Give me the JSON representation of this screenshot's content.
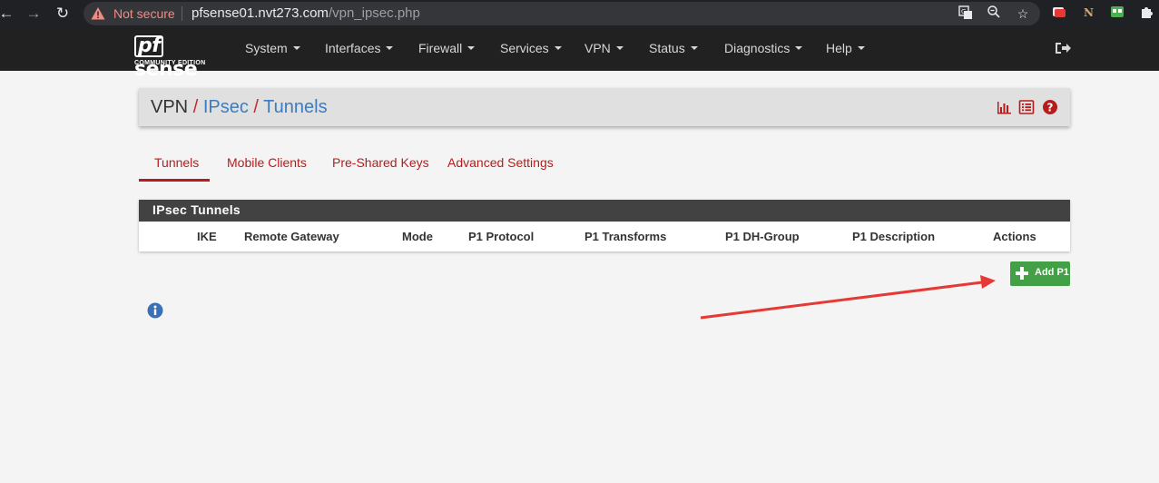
{
  "browser": {
    "security_label": "Not secure",
    "url_host": "pfsense01.nvt273.com",
    "url_path": "/vpn_ipsec.php",
    "back_icon": "arrow-left-icon",
    "forward_icon": "arrow-right-icon",
    "reload_icon": "reload-icon"
  },
  "navbar": {
    "logo_main": "sense",
    "logo_pf": "pf",
    "logo_sub": "COMMUNITY EDITION",
    "items": [
      {
        "label": "System"
      },
      {
        "label": "Interfaces"
      },
      {
        "label": "Firewall"
      },
      {
        "label": "Services"
      },
      {
        "label": "VPN"
      },
      {
        "label": "Status"
      },
      {
        "label": "Diagnostics"
      },
      {
        "label": "Help"
      }
    ]
  },
  "breadcrumb": {
    "part1": "VPN",
    "part2": "IPsec",
    "part3": "Tunnels",
    "separator": "/"
  },
  "tabs": [
    {
      "label": "Tunnels",
      "active": true
    },
    {
      "label": "Mobile Clients"
    },
    {
      "label": "Pre-Shared Keys"
    },
    {
      "label": "Advanced Settings"
    }
  ],
  "table": {
    "title": "IPsec Tunnels",
    "columns": [
      "IKE",
      "Remote Gateway",
      "Mode",
      "P1 Protocol",
      "P1 Transforms",
      "P1 DH-Group",
      "P1 Description",
      "Actions"
    ]
  },
  "actions": {
    "add_label": "Add P1"
  },
  "colors": {
    "navbar": "#212121",
    "accent_red": "#b71c1c",
    "link_blue": "#3b7cc1",
    "add_green": "#43a047",
    "annotation_arrow": "#e53935"
  }
}
